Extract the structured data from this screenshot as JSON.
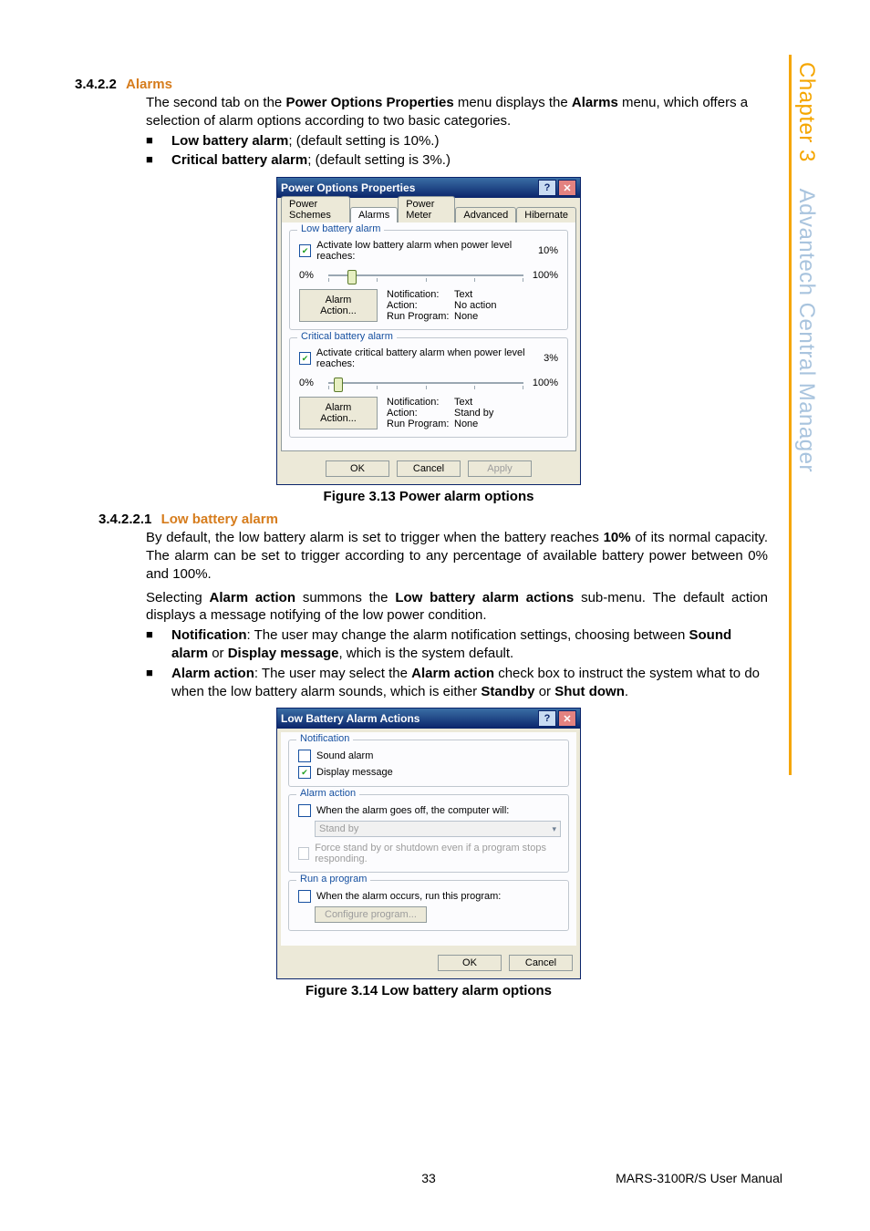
{
  "section_422": {
    "num": "3.4.2.2",
    "title": "Alarms"
  },
  "para_422a": "The second tab on the ",
  "para_422b": "Power Options Properties",
  "para_422c": " menu displays the ",
  "para_422d": "Alarms",
  "para_422e": " menu, which offers a selection of alarm options according to two basic categories.",
  "bullet_422_1a": "Low battery alarm",
  "bullet_422_1b": "; (default setting is 10%.)",
  "bullet_422_2a": "Critical battery alarm",
  "bullet_422_2b": "; (default setting is 3%.)",
  "fig313_caption": "Figure 3.13 Power alarm options",
  "section_4221": {
    "num": "3.4.2.2.1",
    "title": "Low battery alarm"
  },
  "para_4221a": "By default, the low battery alarm is set to trigger when the battery reaches ",
  "para_4221b": "10%",
  "para_4221c": " of its normal capacity. The alarm can be set to trigger according to any percentage of available battery power between 0% and 100%.",
  "para_4221d": "Selecting ",
  "para_4221e": "Alarm action",
  "para_4221f": " summons the ",
  "para_4221g": "Low battery alarm actions",
  "para_4221h": " sub-menu. The default action displays a message notifying of the low power condition.",
  "bullet_4221_1a": "Notification",
  "bullet_4221_1b": ": The user may change the alarm notification settings, choosing between ",
  "bullet_4221_1c": "Sound alarm",
  "bullet_4221_1d": " or ",
  "bullet_4221_1e": "Display message",
  "bullet_4221_1f": ", which is the system default.",
  "bullet_4221_2a": "Alarm action",
  "bullet_4221_2b": ": The user may select the ",
  "bullet_4221_2c": "Alarm action",
  "bullet_4221_2d": " check box to instruct the system what to do when the low battery alarm sounds, which is either ",
  "bullet_4221_2e": "Standby",
  "bullet_4221_2f": " or ",
  "bullet_4221_2g": "Shut down",
  "bullet_4221_2h": ".",
  "fig314_caption": "Figure 3.14 Low battery alarm options",
  "po": {
    "title": "Power Options Properties",
    "help": "?",
    "close": "✕",
    "tabs": {
      "schemes": "Power Schemes",
      "alarms": "Alarms",
      "meter": "Power Meter",
      "advanced": "Advanced",
      "hibernate": "Hibernate"
    },
    "low": {
      "legend": "Low battery alarm",
      "activate": "Activate low battery alarm when power level reaches:",
      "pct": "10%",
      "min": "0%",
      "max": "100%",
      "btn": "Alarm Action...",
      "k1": "Notification:",
      "v1": "Text",
      "k2": "Action:",
      "v2": "No action",
      "k3": "Run Program:",
      "v3": "None"
    },
    "crit": {
      "legend": "Critical battery alarm",
      "activate": "Activate critical battery alarm when power level reaches:",
      "pct": "3%",
      "min": "0%",
      "max": "100%",
      "btn": "Alarm Action...",
      "k1": "Notification:",
      "v1": "Text",
      "k2": "Action:",
      "v2": "Stand by",
      "k3": "Run Program:",
      "v3": "None"
    },
    "ok": "OK",
    "cancel": "Cancel",
    "apply": "Apply"
  },
  "lb": {
    "title": "Low Battery Alarm Actions",
    "help": "?",
    "close": "✕",
    "notif": {
      "legend": "Notification",
      "sound": "Sound alarm",
      "display": "Display message"
    },
    "action": {
      "legend": "Alarm action",
      "when": "When the alarm goes off, the computer will:",
      "standby": "Stand by",
      "force": "Force stand by or shutdown even if a program stops responding."
    },
    "run": {
      "legend": "Run a program",
      "when": "When the alarm occurs, run this program:",
      "cfg": "Configure program..."
    },
    "ok": "OK",
    "cancel": "Cancel"
  },
  "side": {
    "chapter": "Chapter 3",
    "rest": "Advantech Central Manager"
  },
  "footer": {
    "page": "33",
    "manual": "MARS-3100R/S User Manual"
  }
}
